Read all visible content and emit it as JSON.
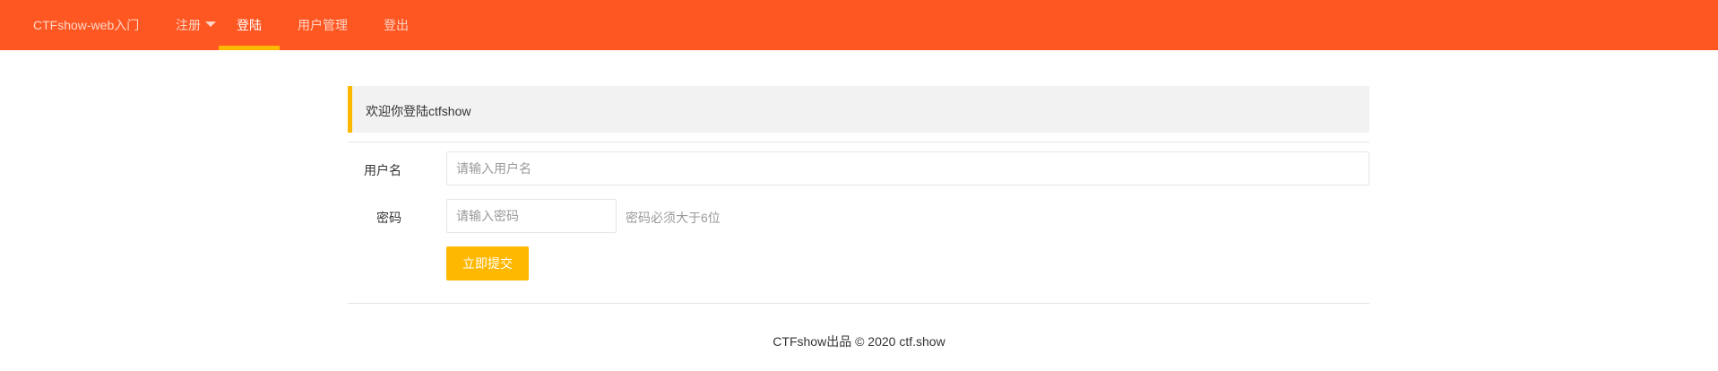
{
  "header": {
    "brand": "CTFshow-web入门",
    "nav": [
      "注册",
      "登陆",
      "用户管理",
      "登出"
    ],
    "active": "登陆"
  },
  "quote": "欢迎你登陆ctfshow",
  "form": {
    "username_label": "用户名",
    "username_placeholder": "请输入用户名",
    "password_label": "密码",
    "password_placeholder": "请输入密码",
    "password_hint": "密码必须大于6位",
    "submit": "立即提交"
  },
  "footer": {
    "text": "CTFshow出品 © 2020 ",
    "link": "ctf.show"
  },
  "colors": {
    "header": "#FF5722",
    "accent": "#FFB800"
  }
}
